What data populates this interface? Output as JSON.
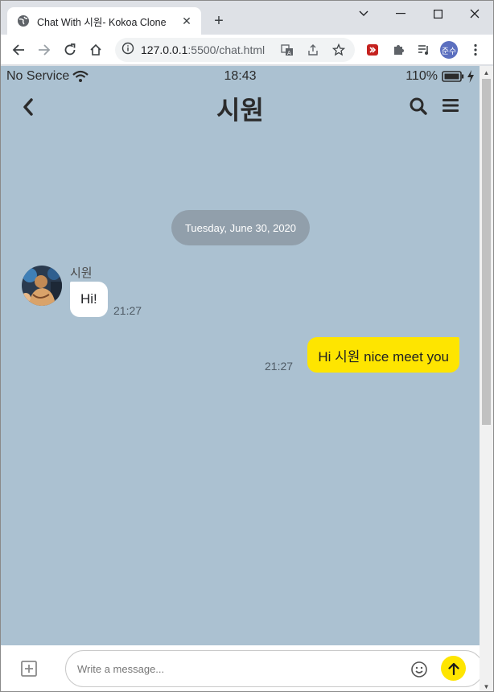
{
  "browser": {
    "tab_title": "Chat With 시원- Kokoa Clone",
    "url_host": "127.0.0.1",
    "url_rest": ":5500/chat.html",
    "profile_initials": "준수"
  },
  "status_bar": {
    "carrier": "No Service",
    "time": "18:43",
    "battery": "110%"
  },
  "chat": {
    "title": "시원",
    "date": "Tuesday, June 30, 2020",
    "messages": [
      {
        "sender": "시원",
        "text": "Hi!",
        "time": "21:27",
        "direction": "incoming"
      },
      {
        "text": "Hi 시원 nice meet you",
        "time": "21:27",
        "direction": "outgoing"
      }
    ]
  },
  "composer": {
    "placeholder": "Write a message..."
  },
  "colors": {
    "background": "#abc1d1",
    "outgoing_bubble": "#fee500",
    "incoming_bubble": "#ffffff",
    "date_pill": "#919fab"
  }
}
